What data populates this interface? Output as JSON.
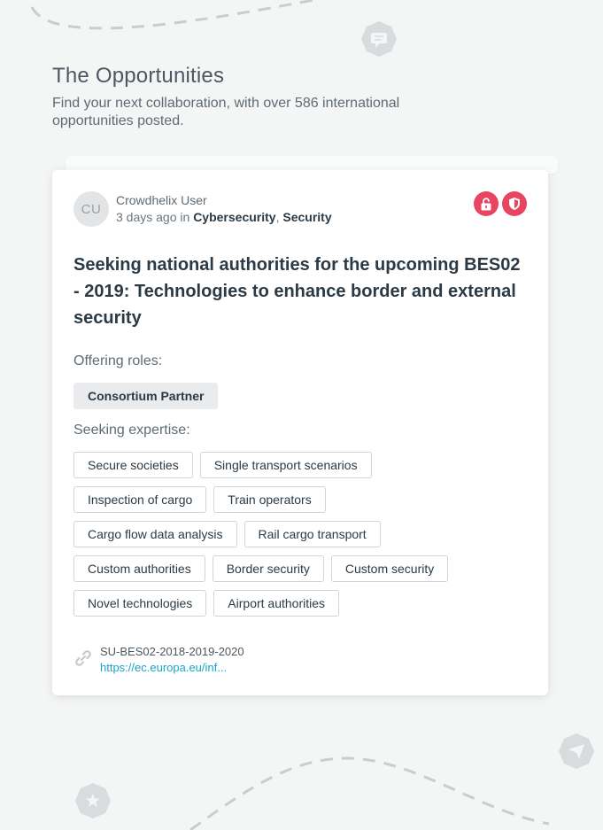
{
  "header": {
    "title": "The Opportunities",
    "subtitle": "Find your next collaboration, with over 586 international opportunities posted."
  },
  "card": {
    "avatar_initials": "CU",
    "author": "Crowdhelix User",
    "posted_ago": "3 days ago in",
    "categories": [
      "Cybersecurity",
      "Security"
    ],
    "badges": [
      {
        "icon": "unlock-icon",
        "color": "#e94560"
      },
      {
        "icon": "shield-icon",
        "color": "#e94560"
      }
    ],
    "title": "Seeking national authorities for the upcoming BES02 - 2019: Technologies to enhance border and external security",
    "offering_label": "Offering roles:",
    "roles": [
      "Consortium Partner"
    ],
    "seeking_label": "Seeking expertise:",
    "expertise": [
      "Secure societies",
      "Single transport scenarios",
      "Inspection of cargo",
      "Train operators",
      "Cargo flow data analysis",
      "Rail cargo transport",
      "Custom authorities",
      "Border security",
      "Custom security",
      "Novel technologies",
      "Airport authorities"
    ],
    "reference_code": "SU-BES02-2018-2019-2020",
    "reference_link": "https://ec.europa.eu/inf..."
  },
  "colors": {
    "accent": "#e94560",
    "link": "#1aa3c8",
    "background": "#f4f5f5"
  }
}
